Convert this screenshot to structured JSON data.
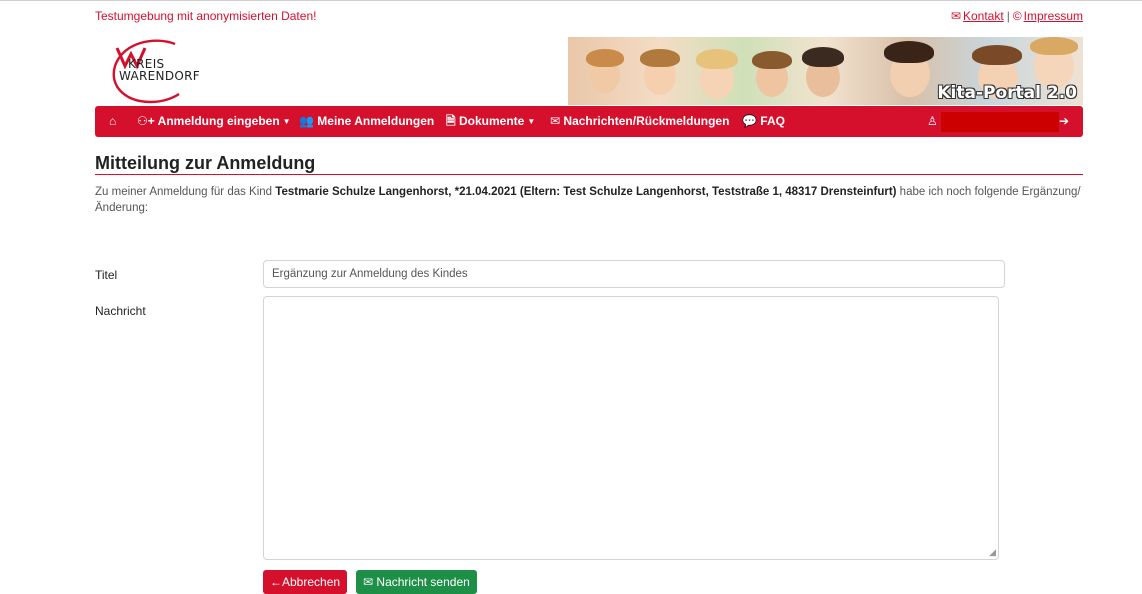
{
  "banner": {
    "test_notice": "Testumgebung mit anonymisierten Daten!"
  },
  "toplinks": {
    "kontakt": "Kontakt",
    "separator": "|",
    "impressum": "Impressum"
  },
  "logo": {
    "line1": "KREIS",
    "line2": "WARENDORF"
  },
  "header_image": {
    "portal_label": "Kita-Portal 2.0"
  },
  "nav": {
    "anmeldung": "Anmeldung eingeben",
    "meine": "Meine Anmeldungen",
    "dokumente": "Dokumente",
    "nachrichten": "Nachrichten/Rückmeldungen",
    "faq": "FAQ"
  },
  "page": {
    "title": "Mitteilung zur Anmeldung",
    "intro_prefix": "Zu meiner Anmeldung für das Kind ",
    "intro_child": "Testmarie Schulze Langenhorst, *21.04.2021 (Eltern: Test Schulze Langenhorst, Teststraße 1, 48317 Drensteinfurt)",
    "intro_suffix": " habe ich noch folgende Ergänzung/Änderung:"
  },
  "form": {
    "title_label": "Titel",
    "title_value": "Ergänzung zur Anmeldung des Kindes",
    "message_label": "Nachricht",
    "message_value": ""
  },
  "buttons": {
    "cancel": "Abbrechen",
    "send": "Nachricht senden"
  },
  "colors": {
    "brand": "#d5102d",
    "success": "#1e8f47"
  },
  "icons": [
    "home-icon",
    "user-plus-icon",
    "people-icon",
    "document-icon",
    "inbox-icon",
    "chat-icon",
    "user-icon",
    "logout-icon",
    "mail-icon",
    "copyright-icon",
    "arrow-left-icon",
    "envelope-send-icon"
  ]
}
